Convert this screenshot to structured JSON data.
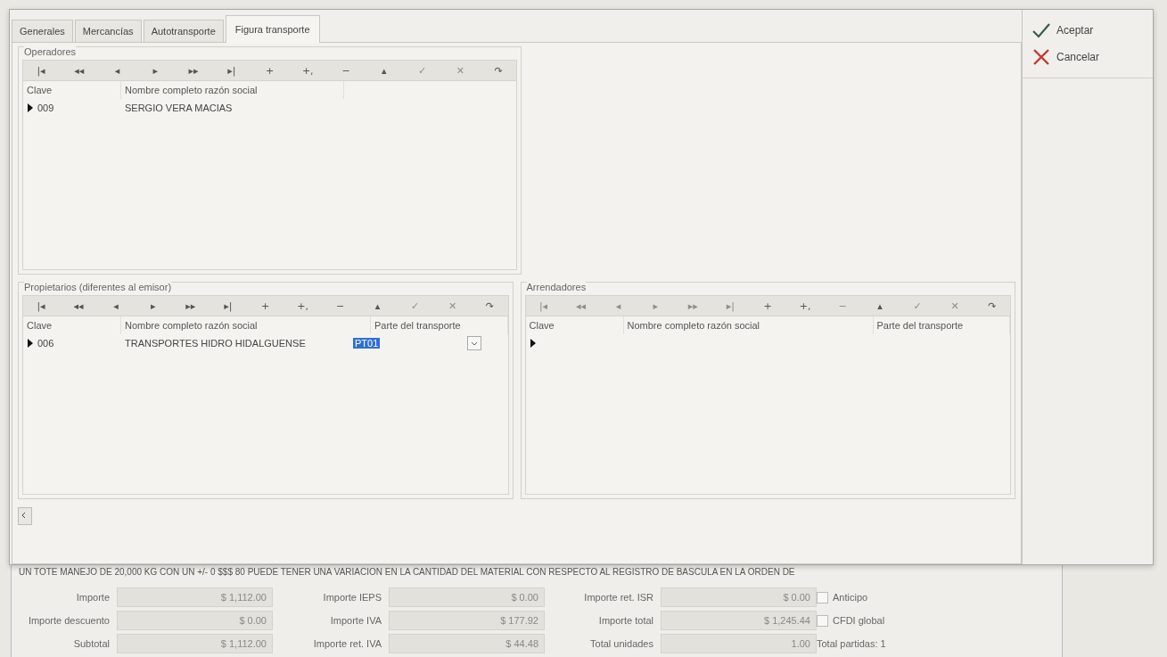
{
  "tabs": [
    {
      "label": "Generales",
      "selected": false
    },
    {
      "label": "Mercancías",
      "selected": false
    },
    {
      "label": "Autotransporte",
      "selected": false
    },
    {
      "label": "Figura transporte",
      "selected": true
    }
  ],
  "operadores": {
    "title": "Operadores",
    "navigator": [
      {
        "glyph": "|◂",
        "disabled": false
      },
      {
        "glyph": "◂◂",
        "disabled": false
      },
      {
        "glyph": "◂",
        "disabled": false
      },
      {
        "glyph": "▸",
        "disabled": false
      },
      {
        "glyph": "▸▸",
        "disabled": false
      },
      {
        "glyph": "▸|",
        "disabled": false
      },
      {
        "glyph": "+",
        "disabled": false
      },
      {
        "glyph": "+,",
        "disabled": false
      },
      {
        "glyph": "−",
        "disabled": false
      },
      {
        "glyph": "▴",
        "disabled": false
      },
      {
        "glyph": "✓",
        "disabled": true
      },
      {
        "glyph": "✕",
        "disabled": true
      },
      {
        "glyph": "↷",
        "disabled": false
      }
    ],
    "columns": [
      "Clave",
      "Nombre completo razón social"
    ],
    "rows": [
      {
        "current": true,
        "cells": [
          "009",
          "SERGIO  VERA MACIAS"
        ]
      }
    ]
  },
  "propietarios": {
    "title": "Propietarios (diferentes al emisor)",
    "navigator": [
      {
        "glyph": "|◂",
        "disabled": false
      },
      {
        "glyph": "◂◂",
        "disabled": false
      },
      {
        "glyph": "◂",
        "disabled": false
      },
      {
        "glyph": "▸",
        "disabled": false
      },
      {
        "glyph": "▸▸",
        "disabled": false
      },
      {
        "glyph": "▸|",
        "disabled": false
      },
      {
        "glyph": "+",
        "disabled": false
      },
      {
        "glyph": "+,",
        "disabled": false
      },
      {
        "glyph": "−",
        "disabled": false
      },
      {
        "glyph": "▴",
        "disabled": false
      },
      {
        "glyph": "✓",
        "disabled": true
      },
      {
        "glyph": "✕",
        "disabled": true
      },
      {
        "glyph": "↷",
        "disabled": false
      }
    ],
    "columns": [
      "Clave",
      "Nombre completo razón social",
      "Parte del transporte"
    ],
    "rows": [
      {
        "current": true,
        "cells": [
          "006",
          "TRANSPORTES HIDRO HIDALGUENSE",
          "PT01"
        ],
        "editing": true
      }
    ]
  },
  "arrendadores": {
    "title": "Arrendadores",
    "navigator": [
      {
        "glyph": "|◂",
        "disabled": true
      },
      {
        "glyph": "◂◂",
        "disabled": true
      },
      {
        "glyph": "◂",
        "disabled": true
      },
      {
        "glyph": "▸",
        "disabled": true
      },
      {
        "glyph": "▸▸",
        "disabled": true
      },
      {
        "glyph": "▸|",
        "disabled": true
      },
      {
        "glyph": "+",
        "disabled": false
      },
      {
        "glyph": "+,",
        "disabled": false
      },
      {
        "glyph": "−",
        "disabled": true
      },
      {
        "glyph": "▴",
        "disabled": false
      },
      {
        "glyph": "✓",
        "disabled": true
      },
      {
        "glyph": "✕",
        "disabled": true
      },
      {
        "glyph": "↷",
        "disabled": false
      }
    ],
    "columns": [
      "Clave",
      "Nombre completo razón social",
      "Parte del transporte"
    ],
    "rows": [
      {
        "current": true,
        "cells": []
      }
    ]
  },
  "actions": [
    {
      "kind": "accept",
      "label": "Aceptar"
    },
    {
      "kind": "cancel",
      "label": "Cancelar"
    }
  ],
  "note": "UN TOTE MANEJO DE 20,000 KG CON UN +/- 0 $$$ 80 PUEDE TENER UNA VARIACION EN LA CANTIDAD DEL MATERIAL CON RESPECTO AL REGISTRO DE BASCULA EN LA ORDEN DE",
  "totals": [
    {
      "label": "Importe",
      "value": "$ 1,112.00"
    },
    {
      "label": "Importe IEPS",
      "value": "$ 0.00"
    },
    {
      "label": "Importe ret. ISR",
      "value": "$ 0.00"
    },
    {
      "label": "Importe descuento",
      "value": "$ 0.00"
    },
    {
      "label": "Importe IVA",
      "value": "$ 177.92"
    },
    {
      "label": "Importe total",
      "value": "$ 1,245.44"
    },
    {
      "label": "Subtotal",
      "value": "$ 1,112.00"
    },
    {
      "label": "Importe ret. IVA",
      "value": "$ 44.48"
    },
    {
      "label": "Total unidades",
      "value": "1.00"
    }
  ],
  "options": [
    {
      "label": "Anticipo",
      "checked": false
    },
    {
      "label": "CFDI global",
      "checked": false
    }
  ],
  "total_partidas": "Total partidas: 1"
}
